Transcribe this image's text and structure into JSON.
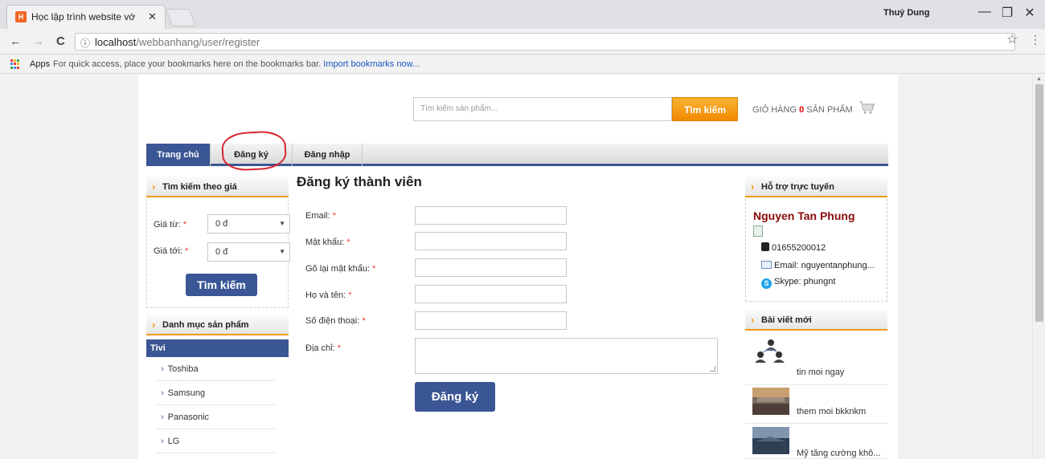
{
  "browser": {
    "tab_title": "Học lập trình website vớ",
    "tab_close": "✕",
    "favicon_text": "H",
    "profile_name": "Thuỷ Dung",
    "minimize": "—",
    "restore": "❐",
    "close": "✕",
    "back": "←",
    "forward": "→",
    "reload": "C",
    "info": "ⓘ",
    "url_host": "localhost",
    "url_path": "/webbanhang/user/register",
    "star": "☆",
    "menu": "⋮",
    "apps_label": "Apps",
    "bookmarks_hint": "For quick access, place your bookmarks here on the bookmarks bar.",
    "import_link": "Import bookmarks now..."
  },
  "header": {
    "search_placeholder": "Tìm kiếm sản phẩm...",
    "search_button": "Tìm kiếm",
    "cart_label": "GIỎ HÀNG",
    "cart_count": "0",
    "cart_suffix": "SẢN PHẨM"
  },
  "nav": {
    "items": [
      {
        "label": "Trang chủ",
        "active": true
      },
      {
        "label": "Đăng ký",
        "active": false
      },
      {
        "label": "Đăng nhập",
        "active": false
      }
    ]
  },
  "sidebar_left": {
    "price_title": "Tìm kiếm theo giá",
    "price_from_label": "Giá từ:",
    "price_to_label": "Giá tới:",
    "required_mark": "*",
    "price_from_value": "0 đ",
    "price_to_value": "0 đ",
    "price_search_button": "Tìm kiếm",
    "category_title": "Danh mục sản phẩm",
    "category_root": "Tivi",
    "categories": [
      "Toshiba",
      "Samsung",
      "Panasonic",
      "LG"
    ]
  },
  "form": {
    "title": "Đăng ký thành viên",
    "fields": [
      {
        "label": "Email:"
      },
      {
        "label": "Mật khẩu:"
      },
      {
        "label": "Gõ lại mật khẩu:"
      },
      {
        "label": "Họ và tên:"
      },
      {
        "label": "Số điện thoại:"
      },
      {
        "label": "Địa chỉ:"
      }
    ],
    "required_mark": "*",
    "submit": "Đăng ký"
  },
  "sidebar_right": {
    "support_title": "Hỗ trợ trực tuyến",
    "support_name": "Nguyen Tan Phung",
    "phone": "01655200012",
    "email": "Email: nguyentanphung...",
    "skype": "Skype: phungnt",
    "skype_icon_letter": "S",
    "posts_title": "Bài viết mới",
    "posts": [
      "tin moi ngay",
      "them moi bkknkm",
      "Mỹ tăng cường khô..."
    ]
  },
  "colors": {
    "primary": "#3b5694",
    "accent": "#f09a1a",
    "highlight": "#d8262f"
  }
}
